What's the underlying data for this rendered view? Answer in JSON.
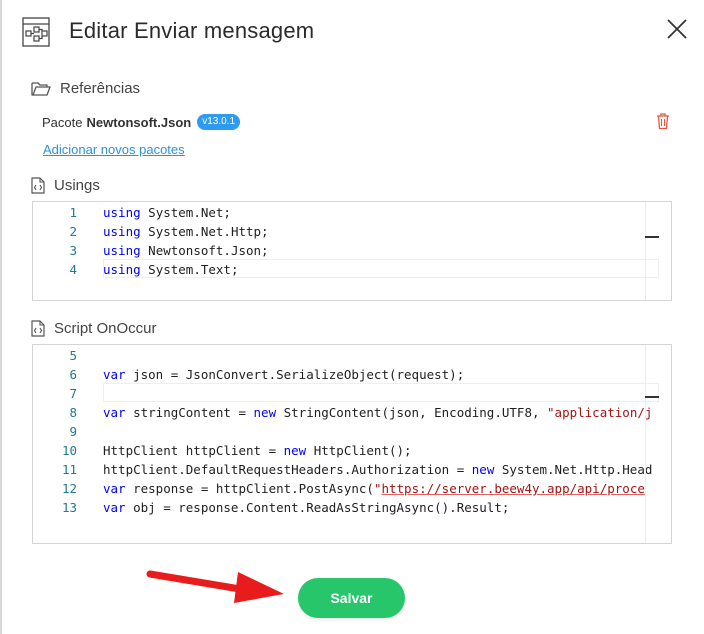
{
  "dialog": {
    "title": "Editar Enviar mensagem",
    "icons": {
      "title": "flowchart-icon",
      "close": "close-icon"
    }
  },
  "references": {
    "heading": "Referências",
    "icon": "folder-open-icon",
    "package": {
      "prefix": "Pacote",
      "name": "Newtonsoft.Json",
      "version": "v13.0.1",
      "delete_icon": "trash-icon"
    },
    "add_link": "Adicionar novos pacotes"
  },
  "usings": {
    "heading": "Usings",
    "icon": "code-file-icon",
    "lines": [
      {
        "n": "1",
        "tokens": [
          {
            "t": "using",
            "k": "kw"
          },
          {
            "t": " System.Net;",
            "k": "plain"
          }
        ]
      },
      {
        "n": "2",
        "tokens": [
          {
            "t": "using",
            "k": "kw"
          },
          {
            "t": " System.Net.Http;",
            "k": "plain"
          }
        ]
      },
      {
        "n": "3",
        "tokens": [
          {
            "t": "using",
            "k": "kw"
          },
          {
            "t": " Newtonsoft.Json;",
            "k": "plain"
          }
        ]
      },
      {
        "n": "4",
        "tokens": [
          {
            "t": "using",
            "k": "kw"
          },
          {
            "t": " System.Text;",
            "k": "plain"
          }
        ]
      }
    ]
  },
  "script": {
    "heading": "Script OnOccur",
    "icon": "code-file-icon",
    "lines": [
      {
        "n": "5",
        "tokens": []
      },
      {
        "n": "6",
        "tokens": [
          {
            "t": "var",
            "k": "kw"
          },
          {
            "t": " json = JsonConvert.SerializeObject(request);",
            "k": "plain"
          }
        ]
      },
      {
        "n": "7",
        "tokens": []
      },
      {
        "n": "8",
        "tokens": [
          {
            "t": "var",
            "k": "kw"
          },
          {
            "t": " stringContent = ",
            "k": "plain"
          },
          {
            "t": "new",
            "k": "kw"
          },
          {
            "t": " StringContent(json, Encoding.UTF8, ",
            "k": "plain"
          },
          {
            "t": "\"application/j",
            "k": "str"
          }
        ]
      },
      {
        "n": "9",
        "tokens": []
      },
      {
        "n": "10",
        "tokens": [
          {
            "t": "HttpClient httpClient = ",
            "k": "plain"
          },
          {
            "t": "new",
            "k": "kw"
          },
          {
            "t": " HttpClient();",
            "k": "plain"
          }
        ]
      },
      {
        "n": "11",
        "tokens": [
          {
            "t": "httpClient.DefaultRequestHeaders.Authorization = ",
            "k": "plain"
          },
          {
            "t": "new",
            "k": "kw"
          },
          {
            "t": " System.Net.Http.Head",
            "k": "plain"
          }
        ]
      },
      {
        "n": "12",
        "tokens": [
          {
            "t": "var",
            "k": "kw"
          },
          {
            "t": " response = httpClient.PostAsync(",
            "k": "plain"
          },
          {
            "t": "\"",
            "k": "str"
          },
          {
            "t": "https://server.beew4y.app/api/proce",
            "k": "url"
          }
        ]
      },
      {
        "n": "13",
        "tokens": [
          {
            "t": "var",
            "k": "kw"
          },
          {
            "t": " obj = response.Content.ReadAsStringAsync().Result;",
            "k": "plain"
          }
        ]
      }
    ]
  },
  "actions": {
    "save_label": "Salvar"
  },
  "colors": {
    "accent": "#27c66a",
    "link": "#2f8fdc",
    "badge": "#2f9bf0",
    "danger": "#e8553d",
    "arrow": "#e81c1c"
  }
}
